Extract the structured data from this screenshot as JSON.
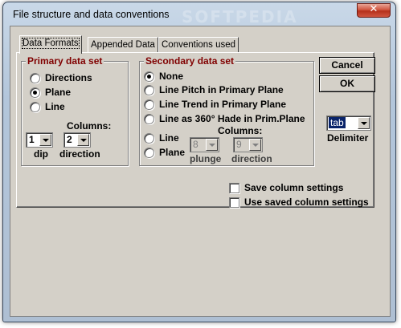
{
  "window": {
    "title": "File structure and data conventions",
    "watermark": "SOFTPEDIA",
    "close_glyph": "✕"
  },
  "tabs": [
    {
      "label": "Data Formats",
      "active": true
    },
    {
      "label": "Appended Data",
      "active": false
    },
    {
      "label": "Conventions used",
      "active": false
    }
  ],
  "primary": {
    "legend": "Primary data set",
    "options": [
      {
        "label": "Directions",
        "checked": false
      },
      {
        "label": "Plane",
        "checked": true
      },
      {
        "label": "Line",
        "checked": false
      }
    ],
    "columns_label": "Columns:",
    "col1_value": "1",
    "col2_value": "2",
    "col1_label": "dip",
    "col2_label": "direction"
  },
  "secondary": {
    "legend": "Secondary data set",
    "options": [
      {
        "label": "None",
        "checked": true
      },
      {
        "label": "Line Pitch in Primary Plane",
        "checked": false
      },
      {
        "label": "Line Trend in Primary Plane",
        "checked": false
      },
      {
        "label": "Line as 360° Hade in Prim.Plane",
        "checked": false
      },
      {
        "label": "Line",
        "checked": false
      },
      {
        "label": "Plane",
        "checked": false
      }
    ],
    "columns_label": "Columns:",
    "col1_value": "8",
    "col2_value": "9",
    "col1_label": "plunge",
    "col2_label": "direction"
  },
  "buttons": {
    "cancel": "Cancel",
    "ok": "OK"
  },
  "delimiter": {
    "value": "tab",
    "label": "Delimiter"
  },
  "settings": {
    "save_label": "Save column settings",
    "use_saved_label": "Use saved column settings"
  }
}
